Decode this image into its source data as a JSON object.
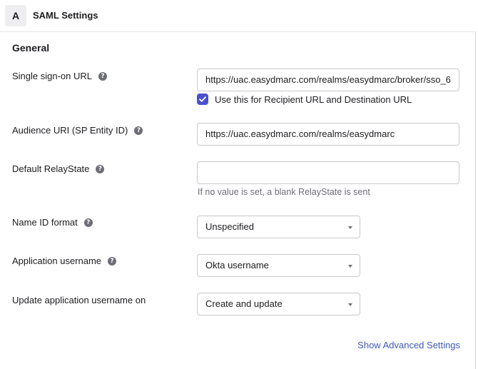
{
  "header": {
    "step": "A",
    "title": "SAML Settings"
  },
  "section": {
    "title": "General"
  },
  "fields": {
    "sso_url": {
      "label": "Single sign-on URL",
      "value": "https://uac.easydmarc.com/realms/easydmarc/broker/sso_6"
    },
    "recipient_checkbox": {
      "label": "Use this for Recipient URL and Destination URL",
      "checked": true
    },
    "audience_uri": {
      "label": "Audience URI (SP Entity ID)",
      "value": "https://uac.easydmarc.com/realms/easydmarc"
    },
    "relay_state": {
      "label": "Default RelayState",
      "value": "",
      "hint": "If no value is set, a blank RelayState is sent"
    },
    "name_id_format": {
      "label": "Name ID format",
      "value": "Unspecified"
    },
    "app_username": {
      "label": "Application username",
      "value": "Okta username"
    },
    "update_username_on": {
      "label": "Update application username on",
      "value": "Create and update"
    }
  },
  "links": {
    "advanced": "Show Advanced Settings"
  },
  "colors": {
    "accent": "#4a4fd1",
    "link": "#3f59b8"
  },
  "icons": {
    "help": "question-circle-icon",
    "check": "checkmark-icon",
    "dropdown": "caret-down-icon"
  }
}
